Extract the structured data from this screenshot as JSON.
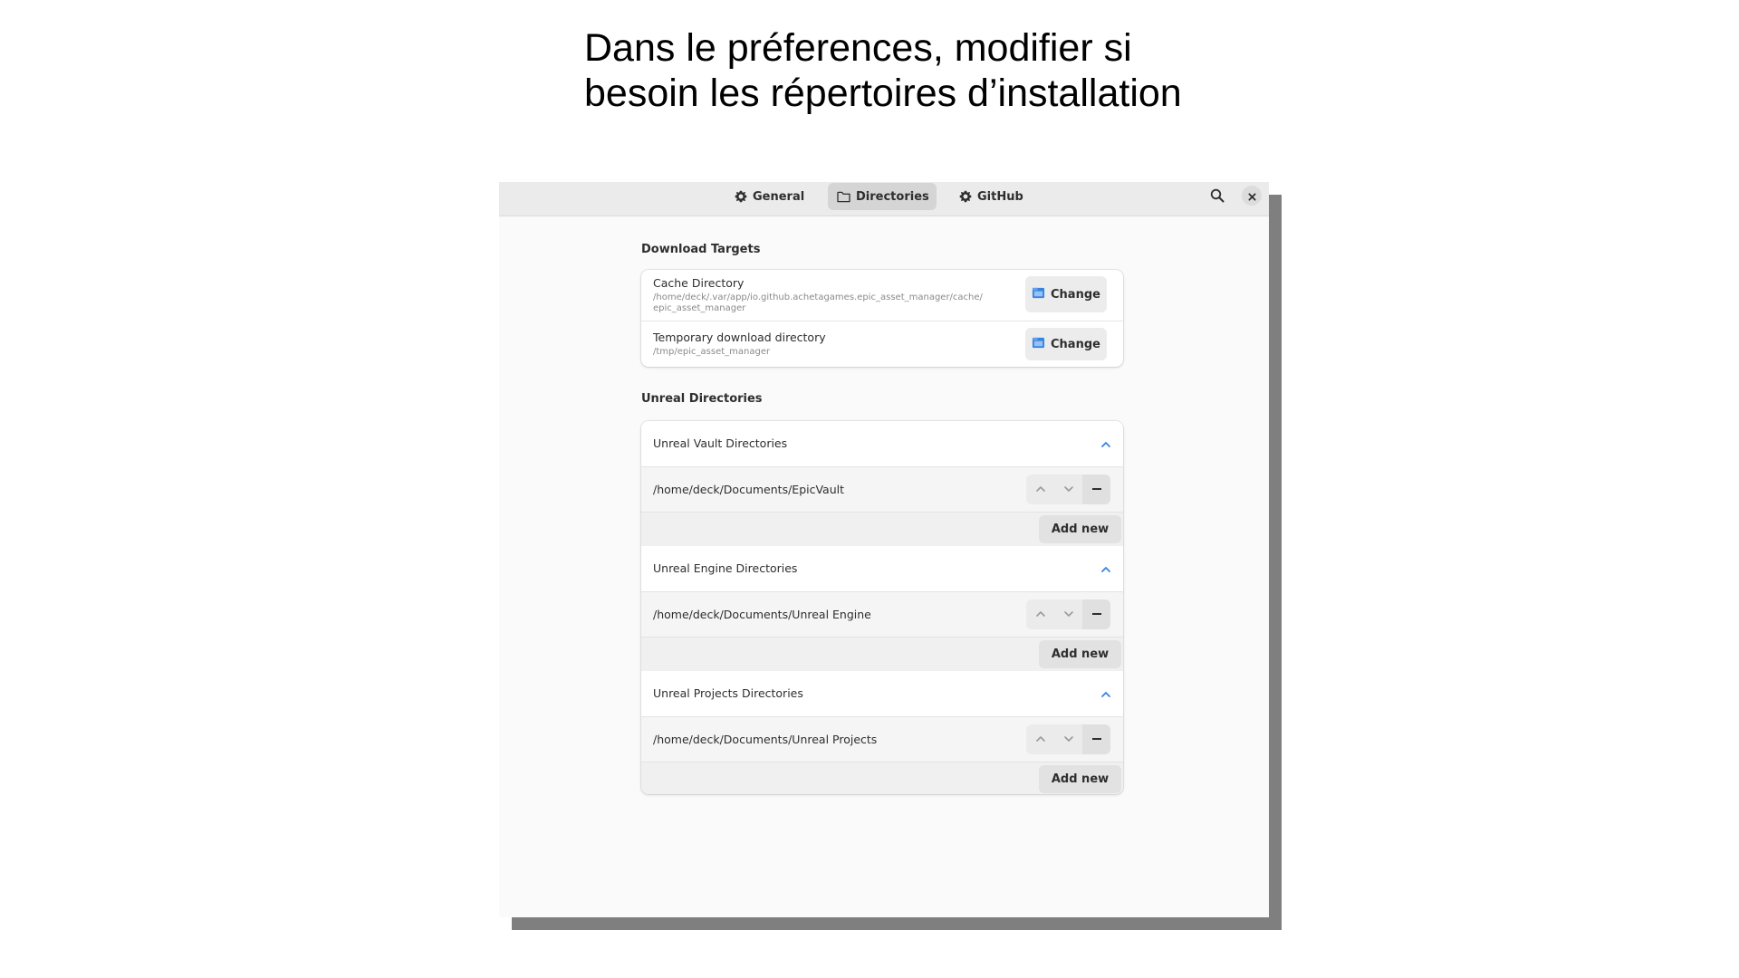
{
  "slide": {
    "title_line1": "Dans le préferences, modifier si",
    "title_line2": "besoin les répertoires d’installation"
  },
  "headerbar": {
    "tabs": [
      {
        "label": "General",
        "icon": "gear-icon"
      },
      {
        "label": "Directories",
        "icon": "folder-icon",
        "active": true
      },
      {
        "label": "GitHub",
        "icon": "gear-icon"
      }
    ],
    "search_icon": "search-icon",
    "close_icon": "close-icon"
  },
  "download_targets": {
    "section_title": "Download Targets",
    "rows": [
      {
        "title": "Cache Directory",
        "path_line1": "/home/deck/.var/app/io.github.achetagames.epic_asset_manager/cache/",
        "path_line2": "epic_asset_manager",
        "button_label": "Change"
      },
      {
        "title": "Temporary download directory",
        "path_line1": "/tmp/epic_asset_manager",
        "button_label": "Change"
      }
    ]
  },
  "unreal_directories": {
    "section_title": "Unreal Directories",
    "groups": [
      {
        "title": "Unreal Vault Directories",
        "entries": [
          "/home/deck/Documents/EpicVault"
        ],
        "add_label": "Add new"
      },
      {
        "title": "Unreal Engine Directories",
        "entries": [
          "/home/deck/Documents/Unreal Engine"
        ],
        "add_label": "Add new"
      },
      {
        "title": "Unreal Projects Directories",
        "entries": [
          "/home/deck/Documents/Unreal Projects"
        ],
        "add_label": "Add new"
      }
    ]
  },
  "colors": {
    "accent": "#3584e4",
    "window_bg": "#fafafa",
    "headerbar_bg": "#ebebeb",
    "shadow": "#7f7f7f"
  }
}
